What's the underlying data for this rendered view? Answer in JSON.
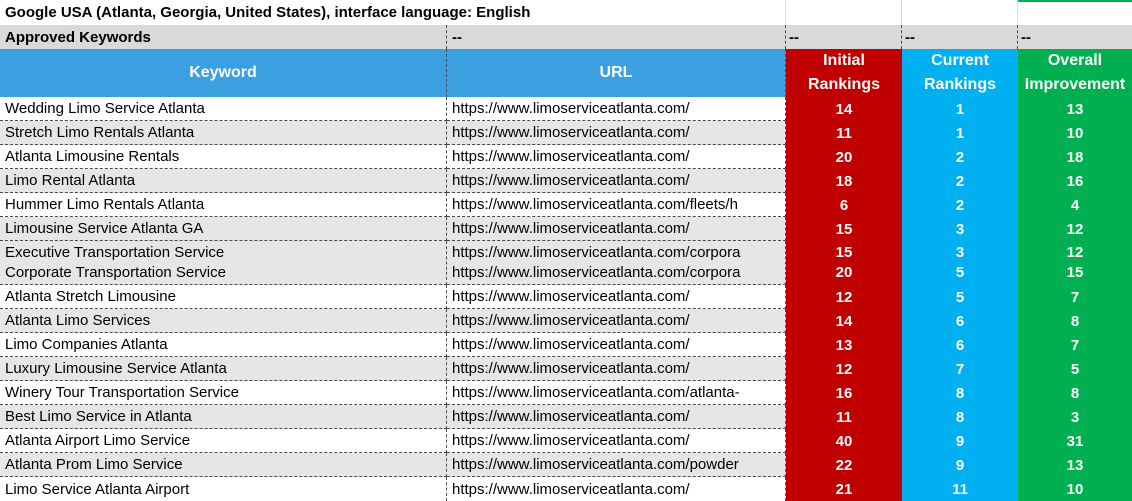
{
  "title": "Google USA (Atlanta, Georgia, United States), interface language: English",
  "approved_label": "Approved Keywords",
  "dash": "--",
  "headers": {
    "keyword": "Keyword",
    "url": "URL",
    "initial": "Initial Rankings",
    "current": "Current Rankings",
    "overall": "Overall Improvement"
  },
  "colors": {
    "initial": "#c00000",
    "current": "#00b0f0",
    "overall": "#00b050",
    "header_blue": "#3aa0e0",
    "row_grey": "#e7e6e6"
  },
  "rows": [
    {
      "keyword": "Wedding Limo Service Atlanta",
      "url": "https://www.limoserviceatlanta.com/",
      "initial": "14",
      "current": "1",
      "improvement": "13"
    },
    {
      "keyword": "Stretch Limo Rentals Atlanta",
      "url": "https://www.limoserviceatlanta.com/",
      "initial": "11",
      "current": "1",
      "improvement": "10"
    },
    {
      "keyword": "Atlanta Limousine Rentals",
      "url": "https://www.limoserviceatlanta.com/",
      "initial": "20",
      "current": "2",
      "improvement": "18"
    },
    {
      "keyword": "Limo Rental Atlanta",
      "url": "https://www.limoserviceatlanta.com/",
      "initial": "18",
      "current": "2",
      "improvement": "16"
    },
    {
      "keyword": "Hummer Limo Rentals Atlanta",
      "url": "https://www.limoserviceatlanta.com/fleets/h",
      "initial": "6",
      "current": "2",
      "improvement": "4"
    },
    {
      "keyword": "Limousine Service Atlanta GA",
      "url": "https://www.limoserviceatlanta.com/",
      "initial": "15",
      "current": "3",
      "improvement": "12"
    },
    {
      "keyword": "Executive Transportation Service",
      "url": "https://www.limoserviceatlanta.com/corpora",
      "initial": "15",
      "current": "3",
      "improvement": "12"
    },
    {
      "keyword": "Corporate Transportation Service",
      "url": "https://www.limoserviceatlanta.com/corpora",
      "initial": "20",
      "current": "5",
      "improvement": "15"
    },
    {
      "keyword": "Atlanta Stretch Limousine",
      "url": "https://www.limoserviceatlanta.com/",
      "initial": "12",
      "current": "5",
      "improvement": "7"
    },
    {
      "keyword": "Atlanta Limo Services",
      "url": "https://www.limoserviceatlanta.com/",
      "initial": "14",
      "current": "6",
      "improvement": "8"
    },
    {
      "keyword": "Limo Companies Atlanta",
      "url": "https://www.limoserviceatlanta.com/",
      "initial": "13",
      "current": "6",
      "improvement": "7"
    },
    {
      "keyword": "Luxury Limousine Service Atlanta",
      "url": "https://www.limoserviceatlanta.com/",
      "initial": "12",
      "current": "7",
      "improvement": "5"
    },
    {
      "keyword": "Winery Tour Transportation Service",
      "url": "https://www.limoserviceatlanta.com/atlanta-",
      "initial": "16",
      "current": "8",
      "improvement": "8"
    },
    {
      "keyword": "Best Limo Service in Atlanta",
      "url": "https://www.limoserviceatlanta.com/",
      "initial": "11",
      "current": "8",
      "improvement": "3"
    },
    {
      "keyword": "Atlanta Airport Limo Service",
      "url": "https://www.limoserviceatlanta.com/",
      "initial": "40",
      "current": "9",
      "improvement": "31"
    },
    {
      "keyword": "Atlanta Prom Limo Service",
      "url": "https://www.limoserviceatlanta.com/powder",
      "initial": "22",
      "current": "9",
      "improvement": "13"
    },
    {
      "keyword": "Limo Service Atlanta Airport",
      "url": "https://www.limoserviceatlanta.com/",
      "initial": "21",
      "current": "11",
      "improvement": "10"
    }
  ]
}
